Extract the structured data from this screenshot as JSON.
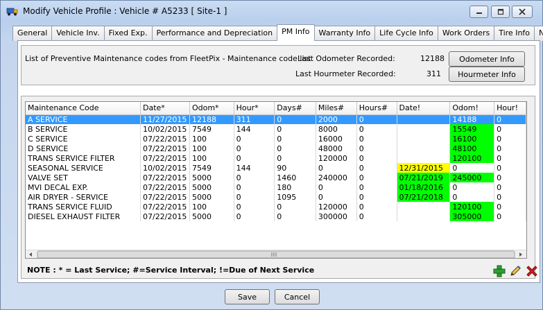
{
  "window": {
    "title": "Modify Vehicle Profile : Vehicle # A5233 [ Site-1 ]"
  },
  "tabs": [
    {
      "label": "General"
    },
    {
      "label": "Vehicle Inv."
    },
    {
      "label": "Fixed Exp."
    },
    {
      "label": "Performance and Depreciation"
    },
    {
      "label": "PM Info"
    },
    {
      "label": "Warranty Info"
    },
    {
      "label": "Life Cycle Info"
    },
    {
      "label": "Work Orders"
    },
    {
      "label": "Tire Info"
    },
    {
      "label": "Notes"
    }
  ],
  "info": {
    "description": "List of Preventive Maintenance codes from FleetPix - Maintenance code list",
    "odometer_label": "Last Odometer Recorded:",
    "odometer_value": "12188",
    "hourmeter_label": "Last Hourmeter Recorded:",
    "hourmeter_value": "311",
    "odometer_button": "Odometer Info",
    "hourmeter_button": "Hourmeter Info"
  },
  "grid": {
    "columns": [
      "Maintenance Code",
      "Date*",
      "Odom*",
      "Hour*",
      "Days#",
      "Miles#",
      "Hours#",
      "Date!",
      "Odom!",
      "Hour!"
    ],
    "rows": [
      {
        "cells": [
          "A SERVICE",
          "11/27/2015",
          "12188",
          "311",
          "0",
          "2000",
          "0",
          "",
          "14188",
          "0"
        ],
        "selected": true,
        "hl": [
          "",
          ""
        ]
      },
      {
        "cells": [
          "B SERVICE",
          "10/02/2015",
          "7549",
          "144",
          "0",
          "8000",
          "0",
          "",
          "15549",
          "0"
        ],
        "selected": false,
        "hl": [
          "",
          "green"
        ]
      },
      {
        "cells": [
          "C SERVICE",
          "07/22/2015",
          "100",
          "0",
          "0",
          "16000",
          "0",
          "",
          "16100",
          "0"
        ],
        "selected": false,
        "hl": [
          "",
          "green"
        ]
      },
      {
        "cells": [
          "D SERVICE",
          "07/22/2015",
          "100",
          "0",
          "0",
          "48000",
          "0",
          "",
          "48100",
          "0"
        ],
        "selected": false,
        "hl": [
          "",
          "green"
        ]
      },
      {
        "cells": [
          "TRANS SERVICE FILTER",
          "07/22/2015",
          "100",
          "0",
          "0",
          "120000",
          "0",
          "",
          "120100",
          "0"
        ],
        "selected": false,
        "hl": [
          "",
          "green"
        ]
      },
      {
        "cells": [
          "SEASONAL SERVICE",
          "10/02/2015",
          "7549",
          "144",
          "90",
          "0",
          "0",
          "12/31/2015",
          "0",
          "0"
        ],
        "selected": false,
        "hl": [
          "yellow",
          ""
        ]
      },
      {
        "cells": [
          "VALVE SET",
          "07/22/2015",
          "5000",
          "0",
          "1460",
          "240000",
          "0",
          "07/21/2019",
          "245000",
          "0"
        ],
        "selected": false,
        "hl": [
          "green",
          "green"
        ]
      },
      {
        "cells": [
          "MVI DECAL EXP.",
          "07/22/2015",
          "5000",
          "0",
          "180",
          "0",
          "0",
          "01/18/2016",
          "0",
          "0"
        ],
        "selected": false,
        "hl": [
          "green",
          ""
        ]
      },
      {
        "cells": [
          "AIR DRYER - SERVICE",
          "07/22/2015",
          "5000",
          "0",
          "1095",
          "0",
          "0",
          "07/21/2018",
          "0",
          "0"
        ],
        "selected": false,
        "hl": [
          "green",
          ""
        ]
      },
      {
        "cells": [
          "TRANS SERVICE FLUID",
          "07/22/2015",
          "100",
          "0",
          "0",
          "120000",
          "0",
          "",
          "120100",
          "0"
        ],
        "selected": false,
        "hl": [
          "",
          "green"
        ]
      },
      {
        "cells": [
          "DIESEL EXHAUST FILTER",
          "07/22/2015",
          "5000",
          "0",
          "0",
          "300000",
          "0",
          "",
          "305000",
          "0"
        ],
        "selected": false,
        "hl": [
          "",
          "green"
        ]
      }
    ]
  },
  "note": "NOTE : * = Last Service; #=Service Interval; !=Due of Next Service",
  "toolbar": {
    "add_icon": "add-plus-icon",
    "edit_icon": "pencil-edit-icon",
    "delete_icon": "red-x-delete-icon"
  },
  "footer": {
    "save_label": "Save",
    "cancel_label": "Cancel"
  },
  "colors": {
    "selection": "#3399ff",
    "due_green": "#00ff00",
    "due_yellow": "#ffff00"
  }
}
